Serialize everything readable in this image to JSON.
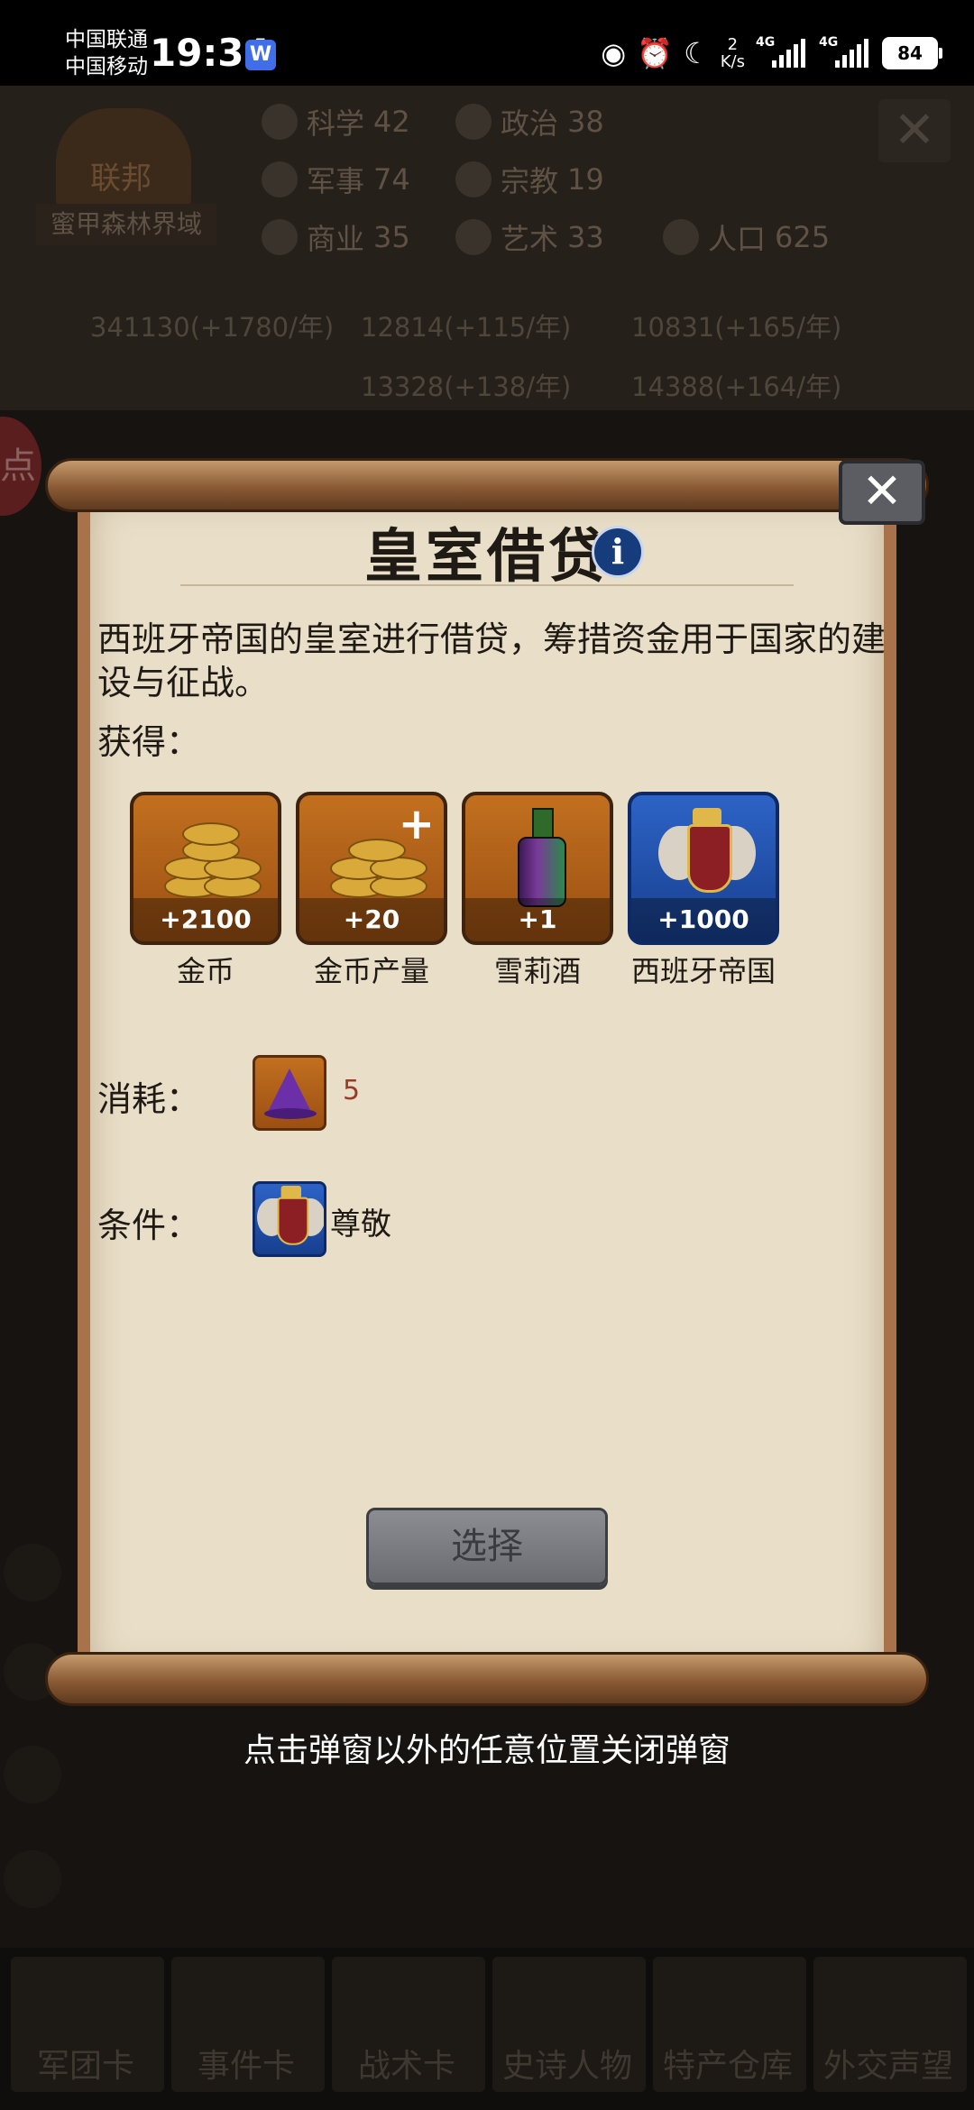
{
  "status_bar": {
    "carrier1": "中国联通",
    "carrier2": "中国移动",
    "time": "19:34",
    "app_icon": "W",
    "net_speed_value": "2",
    "net_speed_unit": "K/s",
    "sim1": "4G",
    "sim2": "4G",
    "battery": "84"
  },
  "background": {
    "emblem_name": "联邦",
    "region": "蜜甲森林界域",
    "stats": [
      {
        "label": "科学",
        "value": "42"
      },
      {
        "label": "政治",
        "value": "38"
      },
      {
        "label": "军事",
        "value": "74"
      },
      {
        "label": "宗教",
        "value": "19"
      },
      {
        "label": "商业",
        "value": "35"
      },
      {
        "label": "艺术",
        "value": "33"
      },
      {
        "label": "人口",
        "value": "625"
      }
    ],
    "resources": [
      "341130(+1780/年)",
      "12814(+115/年)",
      "10831(+165/年)",
      "13328(+138/年)",
      "14388(+164/年)"
    ],
    "side_badge": "点",
    "bottom_tabs": [
      "军团卡",
      "事件卡",
      "战术卡",
      "史诗人物",
      "特产仓库",
      "外交声望"
    ]
  },
  "popup": {
    "title": "皇室借贷",
    "description": "西班牙帝国的皇室进行借贷，筹措资金用于国家的建设与征战。",
    "gain_label": "获得：",
    "rewards": [
      {
        "name": "金币",
        "amount": "+2100",
        "icon": "gold-coins-icon"
      },
      {
        "name": "金币产量",
        "amount": "+20",
        "icon": "gold-income-icon"
      },
      {
        "name": "雪莉酒",
        "amount": "+1",
        "icon": "sherry-bottle-icon"
      },
      {
        "name": "西班牙帝国",
        "amount": "+1000",
        "icon": "spanish-empire-crest-icon"
      }
    ],
    "cost_label": "消耗：",
    "cost_value": "5",
    "cost_icon": "wizard-hat-icon",
    "condition_label": "条件：",
    "condition_text": "尊敬",
    "select_button": "选择",
    "close_icon": "close-icon"
  },
  "hint": "点击弹窗以外的任意位置关闭弹窗"
}
